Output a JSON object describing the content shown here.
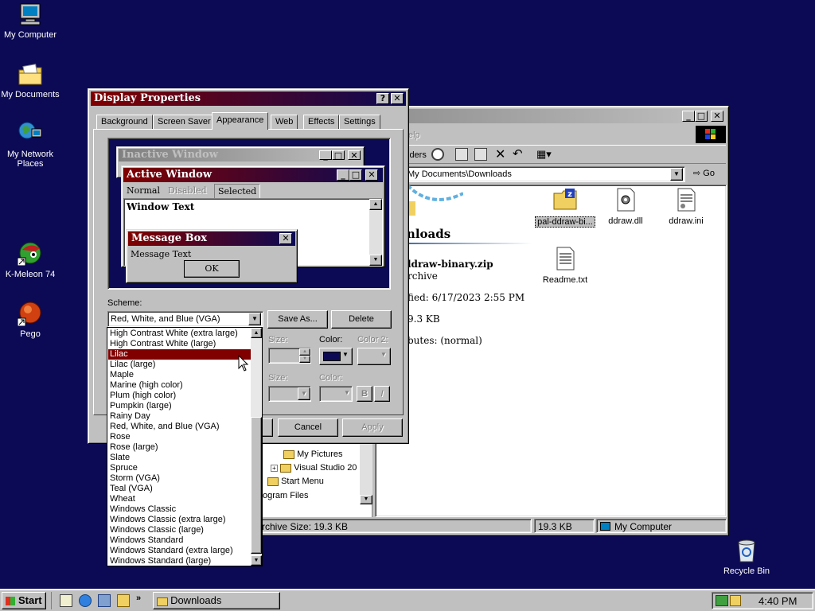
{
  "desktop": {
    "icons": [
      {
        "label": "My Computer",
        "icon": "computer-icon"
      },
      {
        "label": "My Documents",
        "icon": "folder-documents-icon"
      },
      {
        "label": "My Network Places",
        "icon": "network-icon"
      },
      {
        "label": "K-Meleon 74",
        "icon": "browser-icon"
      },
      {
        "label": "Pego",
        "icon": "app-icon"
      },
      {
        "label": "Recycle Bin",
        "icon": "recycle-bin-icon"
      }
    ]
  },
  "explorer": {
    "menu_fragment": "elp",
    "toolbar_folders": "lders",
    "address": "My Documents\\Downloads",
    "go_label": "Go",
    "folder_heading": "wnloads",
    "selected_name": "ldraw-binary.zip",
    "selected_type": "rchive",
    "modified": "fied: 6/17/2023 2:55 PM",
    "size": "9.3 KB",
    "attributes": "butes: (normal)",
    "files": [
      {
        "name": "pal-ddraw-bi...",
        "icon": "zip-folder-icon"
      },
      {
        "name": "ddraw.dll",
        "icon": "dll-file-icon"
      },
      {
        "name": "ddraw.ini",
        "icon": "ini-file-icon"
      },
      {
        "name": "Readme.txt",
        "icon": "text-file-icon"
      }
    ],
    "tree": [
      "My Pictures",
      "Visual Studio 20",
      "Start Menu",
      "ogram Files"
    ],
    "status_left": "rchive Size: 19.3 KB",
    "status_size": "19.3 KB",
    "status_location": "My Computer"
  },
  "dialog": {
    "title": "Display Properties",
    "tabs": [
      "Background",
      "Screen Saver",
      "Appearance",
      "Web",
      "Effects",
      "Settings"
    ],
    "active_tab": "Appearance",
    "preview": {
      "inactive_title": "Inactive Window",
      "active_title": "Active Window",
      "menu_normal": "Normal",
      "menu_disabled": "Disabled",
      "menu_selected": "Selected",
      "window_text": "Window Text",
      "msgbox_title": "Message Box",
      "msgbox_text": "Message Text",
      "ok_label": "OK"
    },
    "scheme_label": "Scheme:",
    "scheme_value": "Red, White, and Blue (VGA)",
    "save_as_label": "Save As...",
    "delete_label": "Delete",
    "size_label": "Size:",
    "color_label": "Color:",
    "color2_label": "Color 2:",
    "size2_label": "Size:",
    "color3_label": "Color:",
    "bold_label": "B",
    "italic_label": "I",
    "cancel_label": "Cancel",
    "apply_label": "Apply",
    "highlight_color": "#800000"
  },
  "scheme_list": {
    "items": [
      "High Contrast White (extra large)",
      "High Contrast White (large)",
      "Lilac",
      "Lilac (large)",
      "Maple",
      "Marine (high color)",
      "Plum (high color)",
      "Pumpkin (large)",
      "Rainy Day",
      "Red, White, and Blue (VGA)",
      "Rose",
      "Rose (large)",
      "Slate",
      "Spruce",
      "Storm (VGA)",
      "Teal (VGA)",
      "Wheat",
      "Windows Classic",
      "Windows Classic (extra large)",
      "Windows Classic (large)",
      "Windows Standard",
      "Windows Standard (extra large)",
      "Windows Standard (large)"
    ],
    "selected": "Lilac"
  },
  "taskbar": {
    "start_label": "Start",
    "task_label": "Downloads",
    "clock": "4:40 PM"
  }
}
